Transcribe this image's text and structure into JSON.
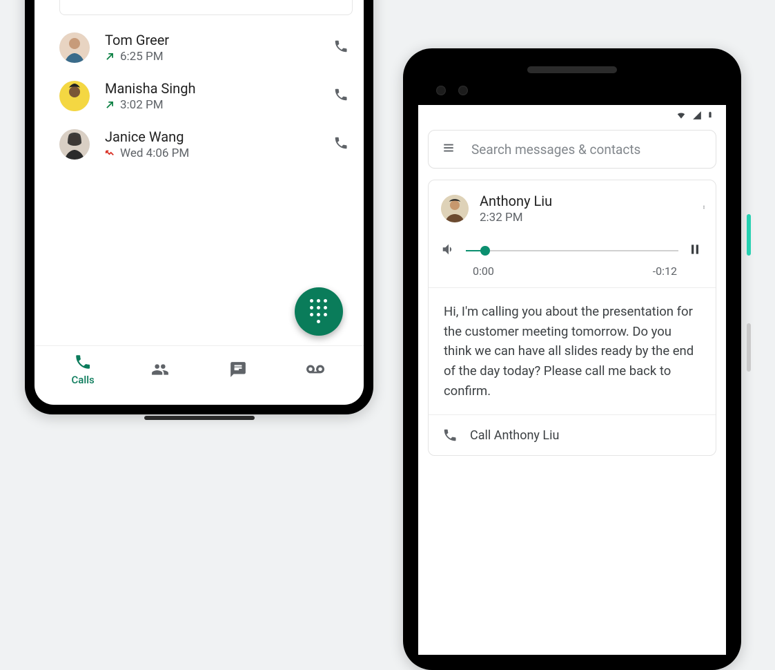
{
  "phone1": {
    "calls": [
      {
        "name": "Tom Greer",
        "time": "6:25 PM",
        "direction": "outgoing"
      },
      {
        "name": "Manisha Singh",
        "time": "3:02 PM",
        "direction": "outgoing"
      },
      {
        "name": "Janice Wang",
        "time": "Wed 4:06 PM",
        "direction": "missed"
      }
    ],
    "nav": {
      "active_label": "Calls",
      "tabs": [
        "calls",
        "contacts",
        "messages",
        "voicemail"
      ]
    },
    "fab": "dialpad"
  },
  "phone2": {
    "status_icons": [
      "wifi",
      "signal",
      "battery"
    ],
    "search": {
      "placeholder": "Search messages & contacts"
    },
    "voicemail": {
      "from": "Anthony Liu",
      "time": "2:32 PM",
      "player": {
        "elapsed": "0:00",
        "remaining": "-0:12",
        "state": "paused",
        "progress_pct": 9
      },
      "transcript": "Hi, I'm calling you about the presentation for the customer meeting tomorrow. Do you think we can have all slides ready by the end of the day today? Please call me back to confirm.",
      "action_label": "Call Anthony Liu"
    }
  },
  "colors": {
    "accent": "#0b8f6f",
    "fab": "#0a7c5a",
    "missed": "#d93025",
    "outgoing": "#0b8043",
    "muted": "#5f6368"
  }
}
